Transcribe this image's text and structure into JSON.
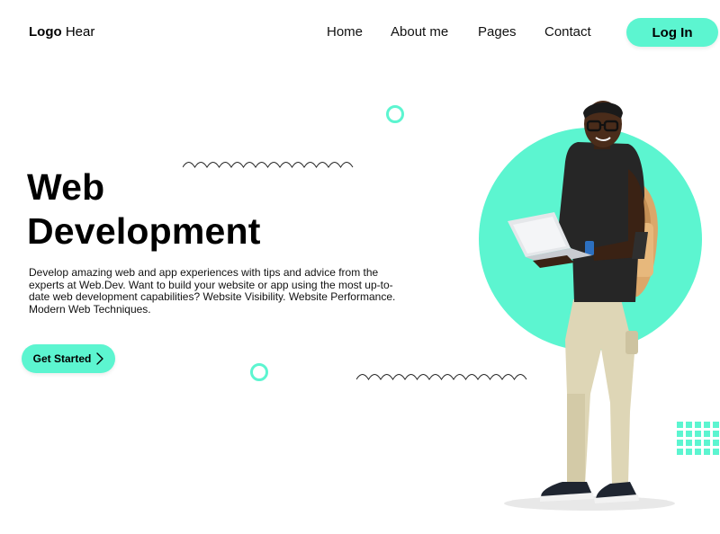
{
  "nav": {
    "logo_bold": "Logo",
    "logo_rest": " Hear",
    "links": [
      {
        "label": "Home"
      },
      {
        "label": "About me"
      },
      {
        "label": "Pages"
      },
      {
        "label": "Contact"
      }
    ],
    "login_label": "Log In"
  },
  "hero": {
    "title_line1": "Web",
    "title_line2": "Development",
    "description": "Develop amazing web and app experiences with tips and advice from the experts at Web.Dev. Want to build your website or app using the most up-to-date web development capabilities? Website Visibility. Website Performance. Modern Web Techniques.",
    "cta_label": "Get Started",
    "cta_icon": "chevron-right-icon"
  },
  "colors": {
    "accent": "#5cf5d0",
    "text": "#000000",
    "background": "#ffffff"
  }
}
